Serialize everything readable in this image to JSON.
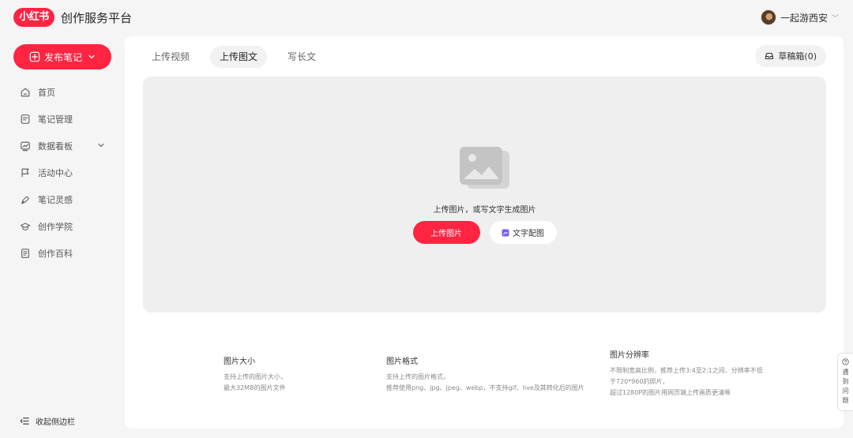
{
  "header": {
    "logo_text": "小红书",
    "platform_title": "创作服务平台",
    "username": "一起游西安"
  },
  "sidebar": {
    "publish_label": "发布笔记",
    "items": [
      {
        "label": "首页",
        "icon": "home-icon"
      },
      {
        "label": "笔记管理",
        "icon": "note-icon"
      },
      {
        "label": "数据看板",
        "icon": "chart-icon",
        "expandable": true
      },
      {
        "label": "活动中心",
        "icon": "flag-icon"
      },
      {
        "label": "笔记灵感",
        "icon": "inspiration-icon"
      },
      {
        "label": "创作学院",
        "icon": "graduation-icon"
      },
      {
        "label": "创作百科",
        "icon": "wiki-icon"
      }
    ],
    "collapse_label": "收起侧边栏"
  },
  "main": {
    "tabs": [
      {
        "label": "上传视频",
        "active": false
      },
      {
        "label": "上传图文",
        "active": true
      },
      {
        "label": "写长文",
        "active": false
      }
    ],
    "drafts_label": "草稿箱(0)",
    "upload": {
      "hint": "上传图片，或写文字生成图片",
      "upload_button": "上传图片",
      "text_image_button": "文字配图"
    },
    "info": {
      "size": {
        "title": "图片大小",
        "lines": [
          "支持上传的图片大小，",
          "最大32MB的图片文件"
        ]
      },
      "format": {
        "title": "图片格式",
        "lines": [
          "支持上传的图片格式，",
          "推荐使用png、jpg、jpeg、webp，不支持gif、live及其转化后的图片"
        ]
      },
      "resolution": {
        "title": "图片分辨率",
        "lines": [
          "不限制宽高比例，推荐上传3:4至2:1之间、分辨率不低于720*960的照片，",
          "超过1280P的图片用网页端上传画质更清晰"
        ]
      }
    }
  },
  "help": {
    "chars": [
      "遇",
      "到",
      "问",
      "题"
    ]
  },
  "colors": {
    "brand": "#ff2442",
    "page_bg": "#f5f5f5",
    "upload_bg": "#efefef"
  }
}
